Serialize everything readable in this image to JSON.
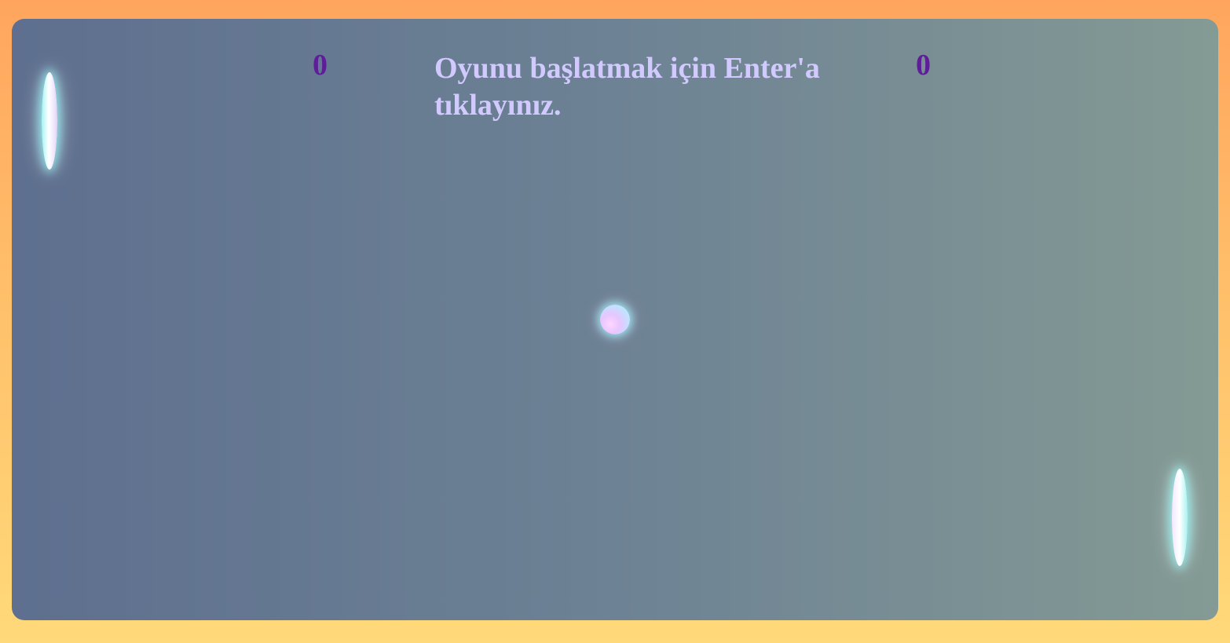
{
  "game": {
    "score_left": "0",
    "score_right": "0",
    "start_message": "Oyunu başlatmak için Enter'a tıklayınız."
  },
  "colors": {
    "score": "#5e1e98",
    "message": "#d2caff",
    "page_background_top": "#ffa55e",
    "page_background_bottom": "#ffd97a",
    "board_left": "#5e6f8f",
    "board_right": "#849a94"
  }
}
